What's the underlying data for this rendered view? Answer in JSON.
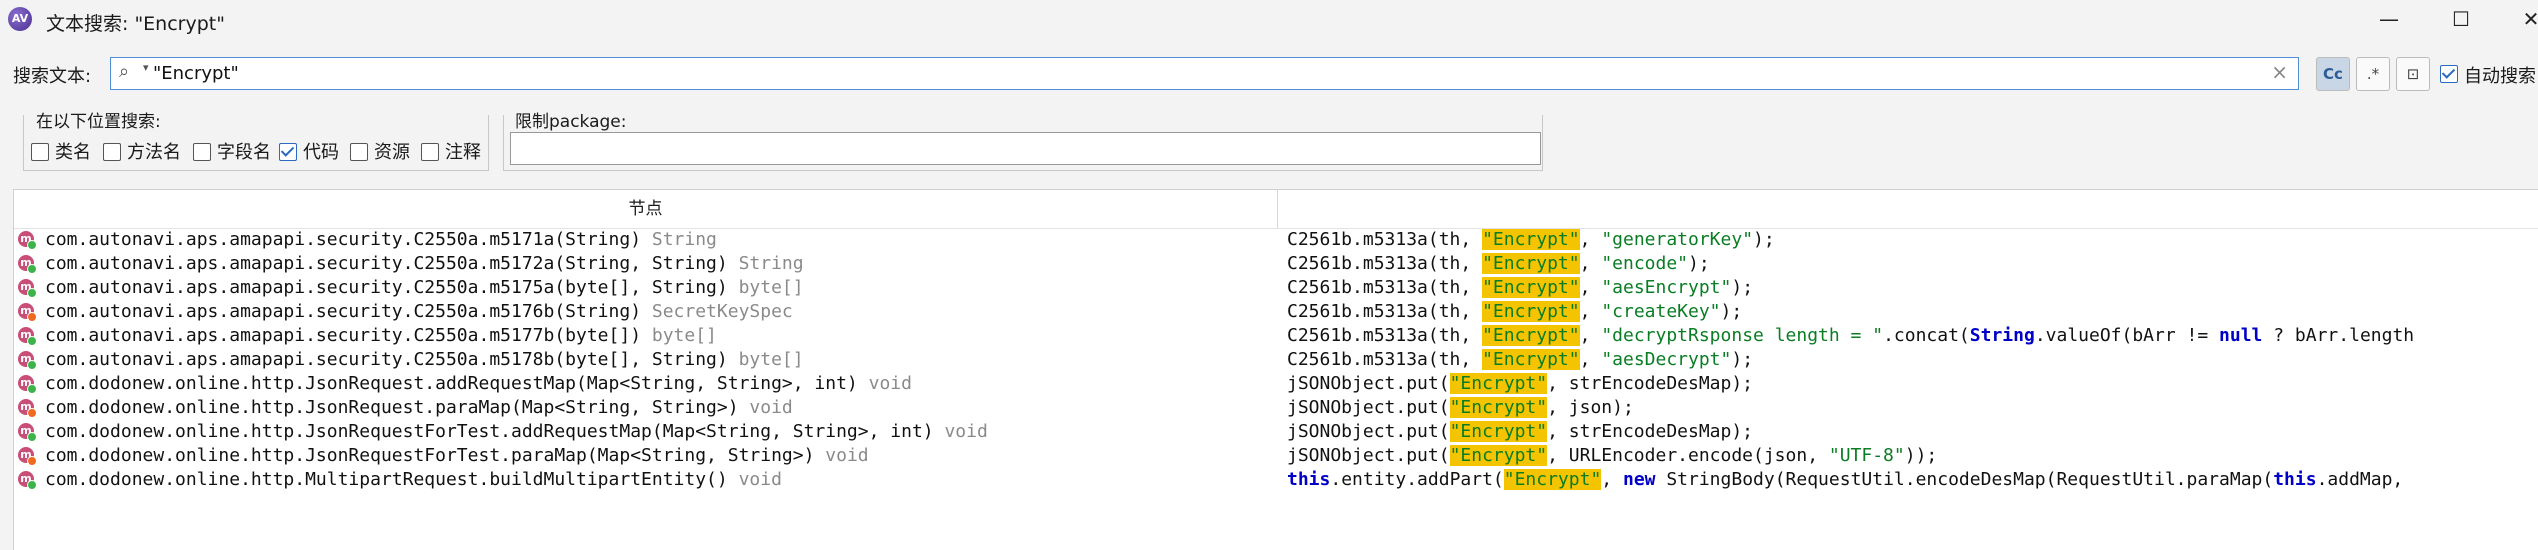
{
  "window": {
    "title": "文本搜索: \"Encrypt\"",
    "icon_text": "AV",
    "controls": {
      "minimize": "—",
      "maximize": "☐",
      "close": "✕"
    }
  },
  "search": {
    "label": "搜索文本:",
    "value": "\"Encrypt\"",
    "auto_search_label": "自动搜索",
    "auto_search_checked": true
  },
  "toolbar": {
    "case_sensitive": "Cc",
    "regex": ".*",
    "active_tab": "⊡"
  },
  "locations": {
    "title": "在以下位置搜索:",
    "options": [
      {
        "label": "类名",
        "checked": false
      },
      {
        "label": "方法名",
        "checked": false
      },
      {
        "label": "字段名",
        "checked": false
      },
      {
        "label": "代码",
        "checked": true
      },
      {
        "label": "资源",
        "checked": false
      },
      {
        "label": "注释",
        "checked": false
      }
    ]
  },
  "package_filter": {
    "title": "限制package:",
    "value": ""
  },
  "results": {
    "header_node": "节点",
    "rows": [
      {
        "dot": "green",
        "node": "com.autonavi.aps.amapapi.security.C2550a.m5171a(String)",
        "ret": "String",
        "code": [
          {
            "t": "plain",
            "v": "C2561b.m5313a(th, "
          },
          {
            "t": "hl",
            "v": "\"Encrypt\""
          },
          {
            "t": "plain",
            "v": ", "
          },
          {
            "t": "str",
            "v": "\"generatorKey\""
          },
          {
            "t": "plain",
            "v": ");"
          }
        ]
      },
      {
        "dot": "green",
        "node": "com.autonavi.aps.amapapi.security.C2550a.m5172a(String, String)",
        "ret": "String",
        "code": [
          {
            "t": "plain",
            "v": "C2561b.m5313a(th, "
          },
          {
            "t": "hl",
            "v": "\"Encrypt\""
          },
          {
            "t": "plain",
            "v": ", "
          },
          {
            "t": "str",
            "v": "\"encode\""
          },
          {
            "t": "plain",
            "v": ");"
          }
        ]
      },
      {
        "dot": "green",
        "node": "com.autonavi.aps.amapapi.security.C2550a.m5175a(byte[], String)",
        "ret": "byte[]",
        "code": [
          {
            "t": "plain",
            "v": "C2561b.m5313a(th, "
          },
          {
            "t": "hl",
            "v": "\"Encrypt\""
          },
          {
            "t": "plain",
            "v": ", "
          },
          {
            "t": "str",
            "v": "\"aesEncrypt\""
          },
          {
            "t": "plain",
            "v": ");"
          }
        ]
      },
      {
        "dot": "orange",
        "node": "com.autonavi.aps.amapapi.security.C2550a.m5176b(String)",
        "ret": "SecretKeySpec",
        "code": [
          {
            "t": "plain",
            "v": "C2561b.m5313a(th, "
          },
          {
            "t": "hl",
            "v": "\"Encrypt\""
          },
          {
            "t": "plain",
            "v": ", "
          },
          {
            "t": "str",
            "v": "\"createKey\""
          },
          {
            "t": "plain",
            "v": ");"
          }
        ]
      },
      {
        "dot": "green",
        "node": "com.autonavi.aps.amapapi.security.C2550a.m5177b(byte[])",
        "ret": "byte[]",
        "code": [
          {
            "t": "plain",
            "v": "C2561b.m5313a(th, "
          },
          {
            "t": "hl",
            "v": "\"Encrypt\""
          },
          {
            "t": "plain",
            "v": ", "
          },
          {
            "t": "str",
            "v": "\"decryptRsponse length = \""
          },
          {
            "t": "plain",
            "v": ".concat("
          },
          {
            "t": "kw",
            "v": "String"
          },
          {
            "t": "plain",
            "v": ".valueOf(bArr != "
          },
          {
            "t": "kw",
            "v": "null"
          },
          {
            "t": "plain",
            "v": " ? bArr.length"
          }
        ]
      },
      {
        "dot": "green",
        "node": "com.autonavi.aps.amapapi.security.C2550a.m5178b(byte[], String)",
        "ret": "byte[]",
        "code": [
          {
            "t": "plain",
            "v": "C2561b.m5313a(th, "
          },
          {
            "t": "hl",
            "v": "\"Encrypt\""
          },
          {
            "t": "plain",
            "v": ", "
          },
          {
            "t": "str",
            "v": "\"aesDecrypt\""
          },
          {
            "t": "plain",
            "v": ");"
          }
        ]
      },
      {
        "dot": "green",
        "node": "com.dodonew.online.http.JsonRequest.addRequestMap(Map<String, String>, int)",
        "ret": "void",
        "code": [
          {
            "t": "plain",
            "v": "jSONObject.put("
          },
          {
            "t": "hl",
            "v": "\"Encrypt\""
          },
          {
            "t": "plain",
            "v": ", strEncodeDesMap);"
          }
        ]
      },
      {
        "dot": "orange",
        "node": "com.dodonew.online.http.JsonRequest.paraMap(Map<String, String>)",
        "ret": "void",
        "code": [
          {
            "t": "plain",
            "v": "jSONObject.put("
          },
          {
            "t": "hl",
            "v": "\"Encrypt\""
          },
          {
            "t": "plain",
            "v": ", json);"
          }
        ]
      },
      {
        "dot": "green",
        "node": "com.dodonew.online.http.JsonRequestForTest.addRequestMap(Map<String, String>, int)",
        "ret": "void",
        "code": [
          {
            "t": "plain",
            "v": "jSONObject.put("
          },
          {
            "t": "hl",
            "v": "\"Encrypt\""
          },
          {
            "t": "plain",
            "v": ", strEncodeDesMap);"
          }
        ]
      },
      {
        "dot": "orange",
        "node": "com.dodonew.online.http.JsonRequestForTest.paraMap(Map<String, String>)",
        "ret": "void",
        "code": [
          {
            "t": "plain",
            "v": "jSONObject.put("
          },
          {
            "t": "hl",
            "v": "\"Encrypt\""
          },
          {
            "t": "plain",
            "v": ", URLEncoder.encode(json, "
          },
          {
            "t": "str",
            "v": "\"UTF-8\""
          },
          {
            "t": "plain",
            "v": "));"
          }
        ]
      },
      {
        "dot": "green",
        "node": "com.dodonew.online.http.MultipartRequest.buildMultipartEntity()",
        "ret": "void",
        "code": [
          {
            "t": "kw",
            "v": "this"
          },
          {
            "t": "plain",
            "v": ".entity.addPart("
          },
          {
            "t": "hl",
            "v": "\"Encrypt\""
          },
          {
            "t": "plain",
            "v": ", "
          },
          {
            "t": "kw",
            "v": "new"
          },
          {
            "t": "plain",
            "v": " StringBody(RequestUtil.encodeDesMap(RequestUtil.paraMap("
          },
          {
            "t": "kw",
            "v": "this"
          },
          {
            "t": "plain",
            "v": ".addMap, "
          }
        ]
      }
    ]
  }
}
